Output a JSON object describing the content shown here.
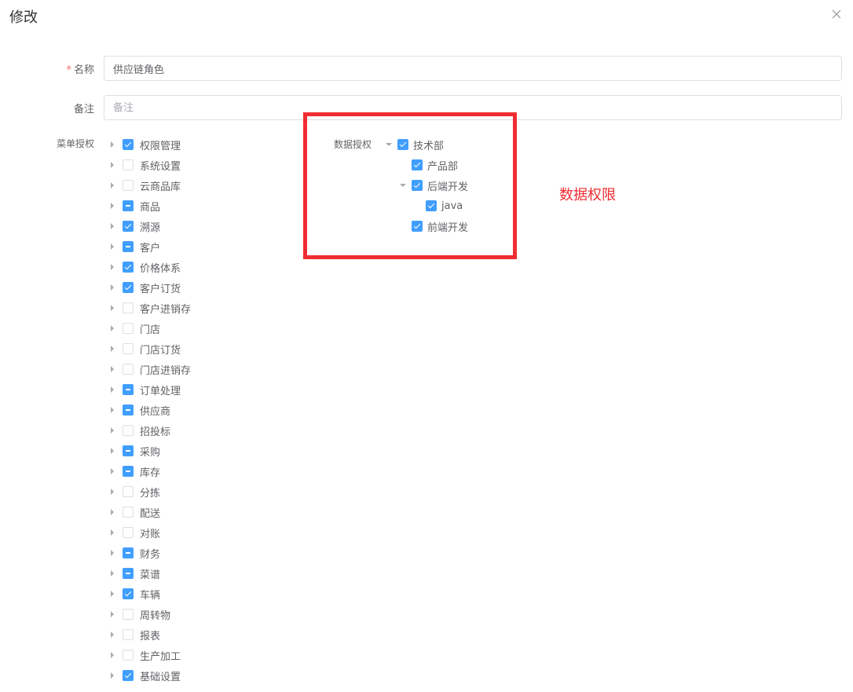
{
  "dialog": {
    "title": "修改"
  },
  "form": {
    "name_label": "名称",
    "name_required": "*",
    "name_value": "供应链角色",
    "remark_label": "备注",
    "remark_placeholder": "备注",
    "menu_label": "菜单授权",
    "data_label": "数据授权"
  },
  "menu_tree": [
    {
      "label": "权限管理",
      "state": "checked"
    },
    {
      "label": "系统设置",
      "state": "unchecked"
    },
    {
      "label": "云商品库",
      "state": "unchecked"
    },
    {
      "label": "商品",
      "state": "indeterminate"
    },
    {
      "label": "溯源",
      "state": "checked"
    },
    {
      "label": "客户",
      "state": "indeterminate"
    },
    {
      "label": "价格体系",
      "state": "checked"
    },
    {
      "label": "客户订货",
      "state": "checked"
    },
    {
      "label": "客户进销存",
      "state": "unchecked"
    },
    {
      "label": "门店",
      "state": "unchecked"
    },
    {
      "label": "门店订货",
      "state": "unchecked"
    },
    {
      "label": "门店进销存",
      "state": "unchecked"
    },
    {
      "label": "订单处理",
      "state": "indeterminate"
    },
    {
      "label": "供应商",
      "state": "indeterminate"
    },
    {
      "label": "招投标",
      "state": "unchecked"
    },
    {
      "label": "采购",
      "state": "indeterminate"
    },
    {
      "label": "库存",
      "state": "indeterminate"
    },
    {
      "label": "分拣",
      "state": "unchecked"
    },
    {
      "label": "配送",
      "state": "unchecked"
    },
    {
      "label": "对账",
      "state": "unchecked"
    },
    {
      "label": "财务",
      "state": "indeterminate"
    },
    {
      "label": "菜谱",
      "state": "indeterminate"
    },
    {
      "label": "车辆",
      "state": "checked"
    },
    {
      "label": "周转物",
      "state": "unchecked"
    },
    {
      "label": "报表",
      "state": "unchecked"
    },
    {
      "label": "生产加工",
      "state": "unchecked"
    },
    {
      "label": "基础设置",
      "state": "checked"
    }
  ],
  "data_tree": [
    {
      "label": "技术部",
      "state": "checked",
      "level": 0,
      "caret": "down"
    },
    {
      "label": "产品部",
      "state": "checked",
      "level": 1,
      "caret": "none"
    },
    {
      "label": "后端开发",
      "state": "checked",
      "level": 1,
      "caret": "down"
    },
    {
      "label": "java",
      "state": "checked",
      "level": 2,
      "caret": "none"
    },
    {
      "label": "前端开发",
      "state": "checked",
      "level": 1,
      "caret": "none"
    }
  ],
  "annotation": {
    "text": "数据权限",
    "color": "#f02d32"
  },
  "colors": {
    "checkbox": "#409eff",
    "required": "#f56c6c"
  }
}
